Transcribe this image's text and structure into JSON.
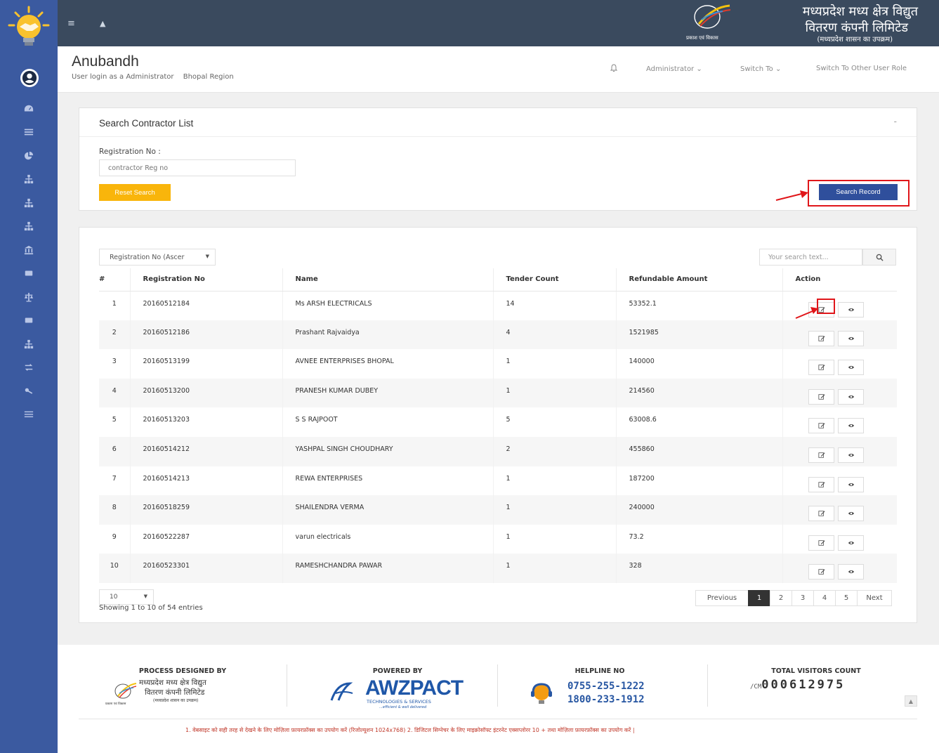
{
  "topbar": {
    "brand_line1": "मध्यप्रदेश मध्य क्षेत्र विद्युत",
    "brand_line2": "वितरण कंपनी लिमिटेड",
    "brand_line3": "(मध्यप्रदेश शासन का उपक्रम)",
    "brand_tagline": "प्रकाश एवं विकास"
  },
  "header": {
    "app_title": "Anubandh",
    "login_text": "User login as a Administrator",
    "region": "Bhopal Region",
    "admin_menu": "Administrator",
    "switch_to": "Switch To",
    "switch_role": "Switch To Other User Role"
  },
  "search_panel": {
    "title": "Search Contractor List",
    "collapse": "-",
    "reg_label": "Registration No :",
    "reg_placeholder": "contractor Reg no",
    "reset_label": "Reset Search",
    "search_label": "Search Record"
  },
  "list_panel": {
    "sort_value": "Registration No (Ascer",
    "search_placeholder": "Your search text...",
    "columns": [
      "#",
      "Registration No",
      "Name",
      "Tender Count",
      "Refundable Amount",
      "Action"
    ],
    "rows": [
      {
        "n": "1",
        "reg": "20160512184",
        "name": "Ms ARSH ELECTRICALS",
        "tenders": "14",
        "amount": "53352.1"
      },
      {
        "n": "2",
        "reg": "20160512186",
        "name": "Prashant Rajvaidya",
        "tenders": "4",
        "amount": "1521985"
      },
      {
        "n": "3",
        "reg": "20160513199",
        "name": "AVNEE ENTERPRISES BHOPAL",
        "tenders": "1",
        "amount": "140000"
      },
      {
        "n": "4",
        "reg": "20160513200",
        "name": "PRANESH KUMAR DUBEY",
        "tenders": "1",
        "amount": "214560"
      },
      {
        "n": "5",
        "reg": "20160513203",
        "name": "S S RAJPOOT",
        "tenders": "5",
        "amount": "63008.6"
      },
      {
        "n": "6",
        "reg": "20160514212",
        "name": "YASHPAL SINGH CHOUDHARY",
        "tenders": "2",
        "amount": "455860"
      },
      {
        "n": "7",
        "reg": "20160514213",
        "name": "REWA ENTERPRISES",
        "tenders": "1",
        "amount": "187200"
      },
      {
        "n": "8",
        "reg": "20160518259",
        "name": "SHAILENDRA VERMA",
        "tenders": "1",
        "amount": "240000"
      },
      {
        "n": "9",
        "reg": "20160522287",
        "name": "varun electricals",
        "tenders": "1",
        "amount": "73.2"
      },
      {
        "n": "10",
        "reg": "20160523301",
        "name": "RAMESHCHANDRA PAWAR",
        "tenders": "1",
        "amount": "328"
      }
    ],
    "page_size": "10",
    "showing": "Showing 1 to 10 of 54 entries",
    "pager": {
      "previous": "Previous",
      "pages": [
        "1",
        "2",
        "3",
        "4",
        "5"
      ],
      "next": "Next",
      "active": "1"
    }
  },
  "footer": {
    "process_head": "PROCESS DESIGNED BY",
    "process_line1": "मध्यप्रदेश मध्य क्षेत्र विद्युत",
    "process_line2": "वितरण कंपनी लिमिटेड",
    "process_line3": "(मध्यप्रदेश शासन का उपक्रम)",
    "process_tag": "प्रकाश एवं विकास",
    "powered_head": "POWERED BY",
    "powered_name": "AWZPACT",
    "powered_sub": "TECHNOLOGIES & SERVICES",
    "powered_tag": "...efficient & well delivered",
    "helpline_head": "HELPLINE NO",
    "helpline1": "0755-255-1222",
    "helpline2": "1800-233-1912",
    "visitors_head": "TOTAL VISITORS COUNT",
    "visitors_prefix": "/CM",
    "visitors_count": "000612975",
    "note": "1. वेबसाइट को सही तरह से देखने के लिए मोज़िला फ़ायरफ़ॉक्स का उपयोग करें (रिजोल्यूशन 1024x768) 2. डिजिटल सिग्नेचर के लिए माइक्रोसॉफ्ट इंटरनेट एक्सप्लोरर 10 + तथा मोज़िला फ़ायरफ़ॉक्स का उपयोग करें |"
  }
}
